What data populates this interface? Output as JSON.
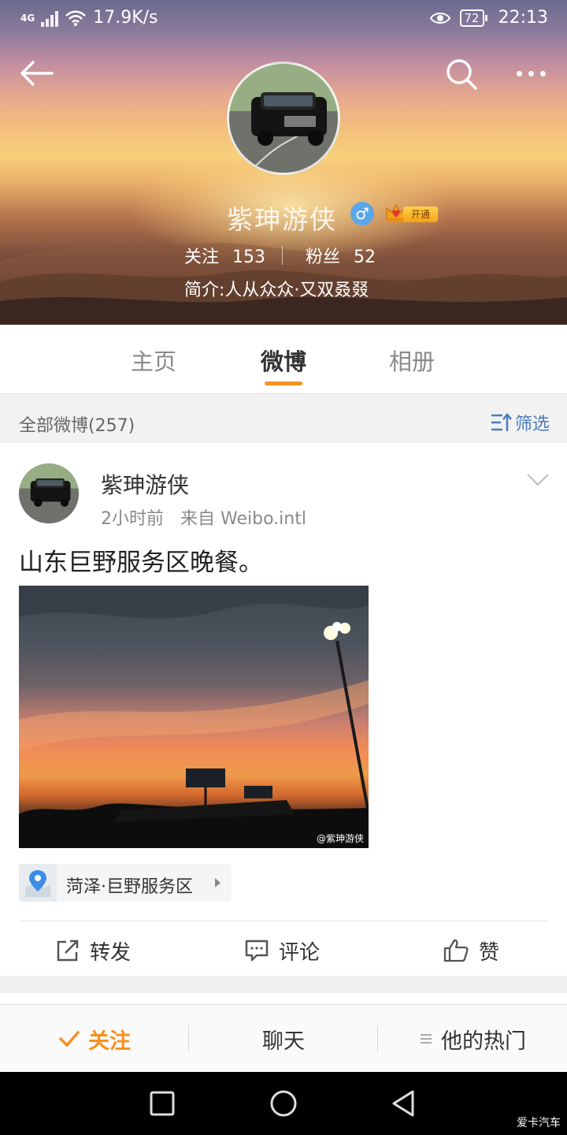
{
  "status_bar": {
    "network": "4G",
    "speed": "17.9K/s",
    "battery": "72",
    "time": "22:13"
  },
  "profile": {
    "name": "紫珅游侠",
    "gender_symbol": "♂",
    "vip_label": "开通",
    "follow_label": "关注",
    "follow_count": "153",
    "fans_label": "粉丝",
    "fans_count": "52",
    "bio": "简介:人从众众·又双叒叕"
  },
  "tabs": [
    {
      "label": "主页",
      "active": false
    },
    {
      "label": "微博",
      "active": true
    },
    {
      "label": "相册",
      "active": false
    }
  ],
  "filter_bar": {
    "count_label": "全部微博(257)",
    "filter_label": "筛选"
  },
  "post": {
    "author": "紫珅游侠",
    "time": "2小时前",
    "source": "来自 Weibo.intl",
    "text": "山东巨野服务区晚餐。",
    "photo_watermark": "@紫珅游侠",
    "location": "菏泽·巨野服务区",
    "actions": {
      "repost": "转发",
      "comment": "评论",
      "like": "赞"
    }
  },
  "bottom_bar": {
    "follow": "关注",
    "chat": "聊天",
    "hot": "他的热门"
  },
  "corner_watermark": "爱卡汽车",
  "colors": {
    "accent_orange": "#f7901e",
    "filter_blue": "#4b7cbf",
    "gender_blue": "#5aa6e8"
  }
}
